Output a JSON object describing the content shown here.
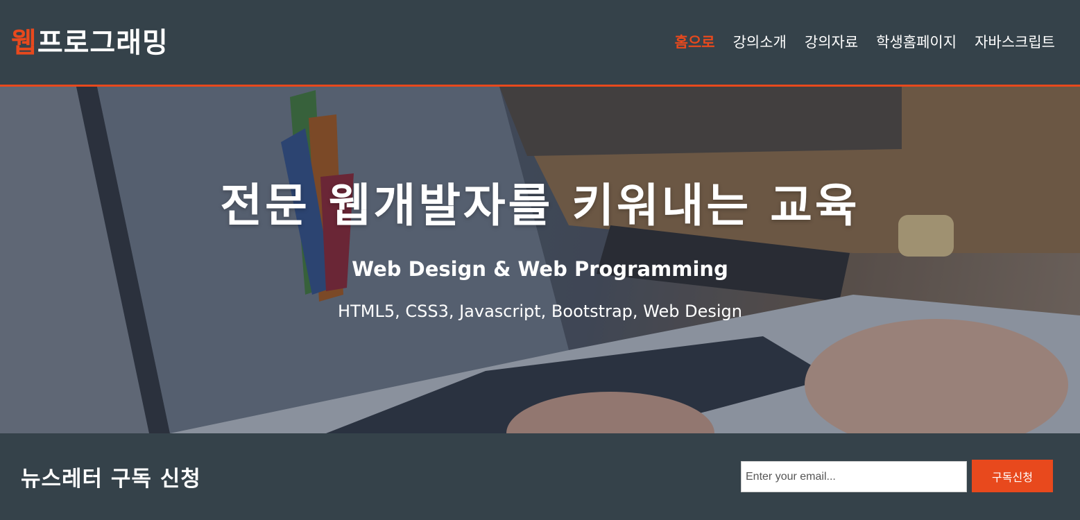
{
  "header": {
    "logo_accent": "웹",
    "logo_rest": "프로그래밍",
    "nav": [
      {
        "label": "홈으로",
        "active": true
      },
      {
        "label": "강의소개",
        "active": false
      },
      {
        "label": "강의자료",
        "active": false
      },
      {
        "label": "학생홈페이지",
        "active": false
      },
      {
        "label": "자바스크립트",
        "active": false
      }
    ]
  },
  "hero": {
    "title": "전문 웹개발자를 키워내는 교육",
    "subtitle": "Web Design & Web Programming",
    "tags": "HTML5, CSS3, Javascript, Bootstrap, Web Design"
  },
  "newsletter": {
    "title": "뉴스레터 구독 신청",
    "email_placeholder": "Enter your email...",
    "email_value": "",
    "subscribe_label": "구독신청"
  },
  "colors": {
    "primary_bg": "#35424a",
    "accent": "#e8491d",
    "text": "#ffffff"
  }
}
